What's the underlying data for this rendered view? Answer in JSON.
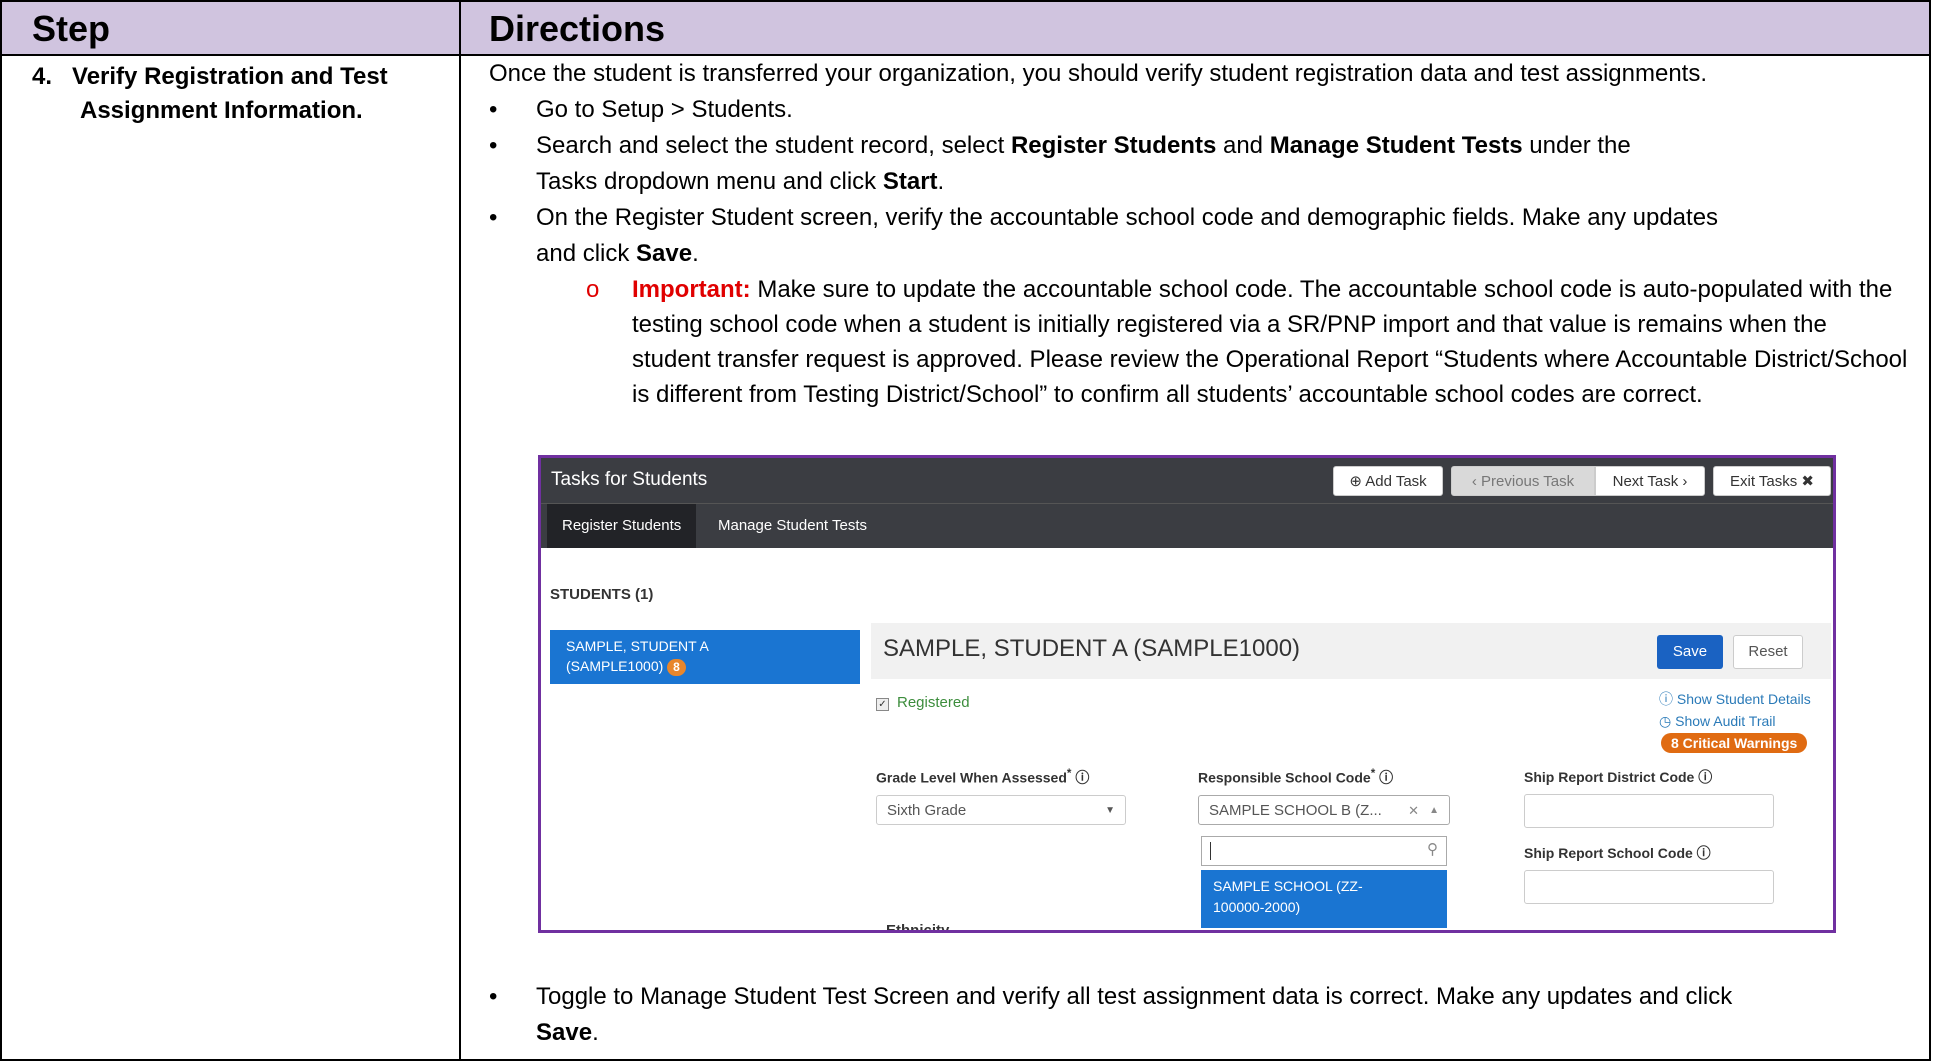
{
  "table": {
    "header_step": "Step",
    "header_directions": "Directions",
    "step_line1": "4.   Verify Registration and Test",
    "step_line2": "Assignment  Information."
  },
  "directions": {
    "intro": "Once the student is transferred your organization, you should verify student registration data and test assignments.",
    "bullet1": "Go to Setup > Students.",
    "bullet2_a": "Search and select the student record, select ",
    "bullet2_b1": "Register Students",
    "bullet2_c": " and ",
    "bullet2_b2": "Manage Student Tests",
    "bullet2_d": " under the",
    "bullet2_e": "Tasks dropdown menu and click ",
    "bullet2_b3": "Start",
    "bullet2_f": ".",
    "bullet3_a": "On the Register Student screen, verify the accountable school code and demographic fields. Make any updates",
    "bullet3_b": "and click ",
    "bullet3_b1": "Save",
    "bullet3_c": ".",
    "sub_marker": "o",
    "important_label": "Important:",
    "important_text": " Make sure to update the accountable school code. The accountable school code is auto-populated with the testing school code when a student is initially registered via a SR/PNP import and that value is remains when the student transfer request is approved. Please review the Operational Report “Students where Accountable District/School is different from Testing District/School” to confirm all students’ accountable school codes are correct.",
    "bullet4_a": "Toggle to Manage Student Test Screen and verify all test assignment data is correct. Make any updates and click",
    "bullet4_b1": "Save",
    "bullet4_c": ".",
    "bullet_char": "•"
  },
  "screenshot": {
    "title": "Tasks for Students",
    "add_task": "Add Task",
    "previous_task": "Previous Task",
    "next_task": "Next Task",
    "exit_tasks": "Exit Tasks",
    "tab_register": "Register Students",
    "tab_manage": "Manage Student Tests",
    "students_heading": "STUDENTS (1)",
    "student_item_line1": "SAMPLE, STUDENT A",
    "student_item_line2": "(SAMPLE1000)",
    "student_badge": "8",
    "student_name": "SAMPLE, STUDENT A (SAMPLE1000)",
    "save": "Save",
    "reset": "Reset",
    "registered": "Registered",
    "show_details": "Show Student Details",
    "show_audit": "Show Audit Trail",
    "critical_warnings": "8 Critical Warnings",
    "grade_label": "Grade Level When Assessed",
    "grade_value": "Sixth Grade",
    "resp_label": "Responsible School Code",
    "resp_value": "SAMPLE SCHOOL B (Z...",
    "resp_option_line1": "SAMPLE SCHOOL (ZZ-",
    "resp_option_line2": "100000-2000)",
    "ship_district_label": "Ship Report District Code",
    "ship_school_label": "Ship Report School Code",
    "ethnicity_label": "Ethnicity"
  }
}
